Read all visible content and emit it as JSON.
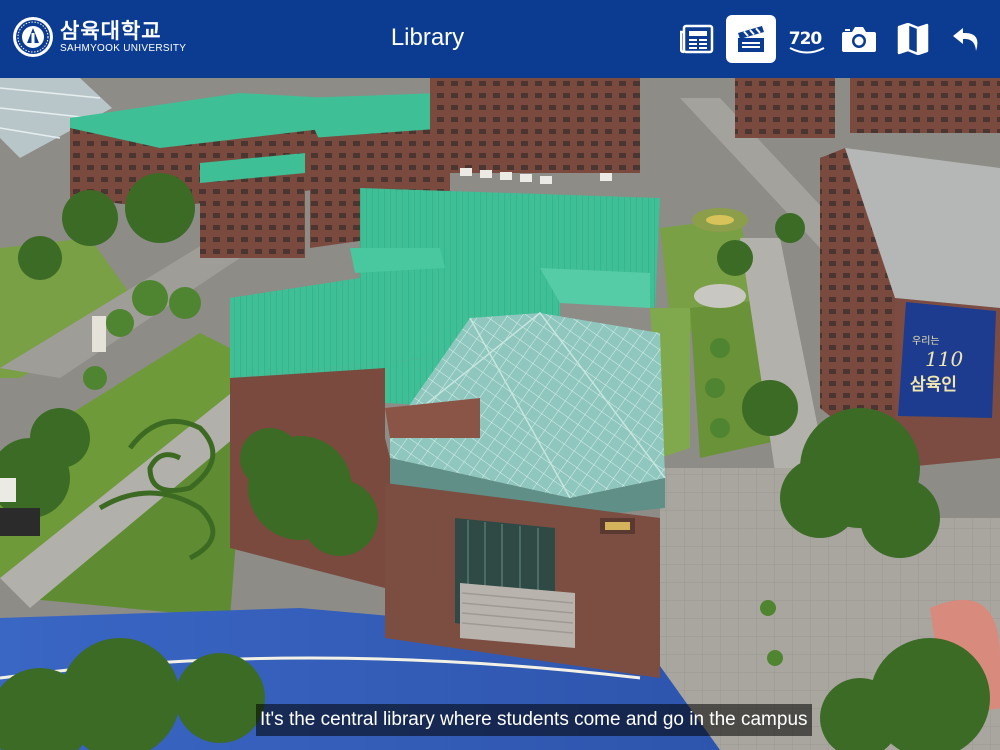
{
  "header": {
    "logo_korean": "삼육대학교",
    "logo_english": "SAHMYOOK UNIVERSITY",
    "title": "Library"
  },
  "toolbar": {
    "items": [
      {
        "icon": "newspaper-icon",
        "active": false
      },
      {
        "icon": "clapperboard-icon",
        "active": true
      },
      {
        "icon": "vr-720-icon",
        "label": "720",
        "active": false
      },
      {
        "icon": "camera-icon",
        "active": false
      },
      {
        "icon": "map-icon",
        "active": false
      },
      {
        "icon": "back-arrow-icon",
        "active": false
      }
    ]
  },
  "banner": {
    "text_top": "우리는",
    "text_big": "110",
    "text_main": "삼육인"
  },
  "caption": {
    "text": "It's the central library where students come and go in the campus"
  },
  "colors": {
    "header_bg": "#0c3c91",
    "roof_green": "#3fbf95",
    "brick": "#7a4a3f",
    "grass": "#6f9a3a"
  }
}
